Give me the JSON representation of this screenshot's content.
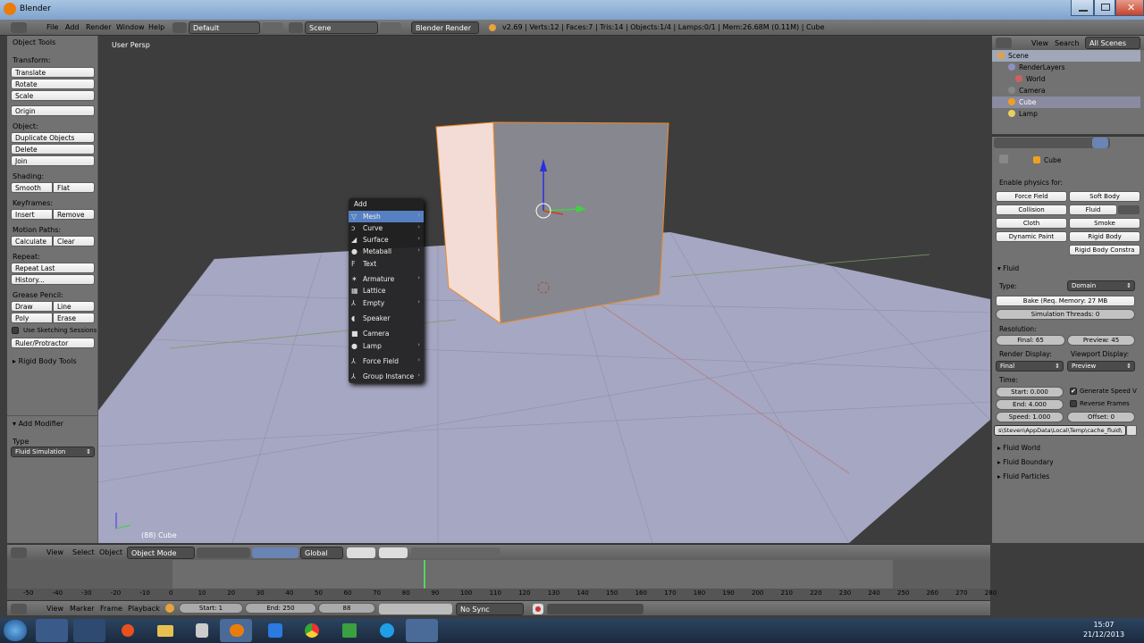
{
  "window": {
    "title": "Blender"
  },
  "menu": {
    "file": "File",
    "add": "Add",
    "render": "Render",
    "window": "Window",
    "help": "Help"
  },
  "info": {
    "layout": "Default",
    "scene": "Scene",
    "engine": "Blender Render",
    "stats": "v2.69 | Verts:12 | Faces:7 | Tris:14 | Objects:1/4 | Lamps:0/1 | Mem:26.68M (0.11M) | Cube"
  },
  "tools": {
    "panel": "Object Tools",
    "transform": "Transform:",
    "translate": "Translate",
    "rotate": "Rotate",
    "scale": "Scale",
    "origin": "Origin",
    "object": "Object:",
    "duplicate": "Duplicate Objects",
    "delete": "Delete",
    "join": "Join",
    "shading": "Shading:",
    "smooth": "Smooth",
    "flat": "Flat",
    "keyframes": "Keyframes:",
    "insert": "Insert",
    "remove": "Remove",
    "motion": "Motion Paths:",
    "calculate": "Calculate",
    "clear": "Clear",
    "repeat": "Repeat:",
    "repeat_last": "Repeat Last",
    "history": "History...",
    "grease": "Grease Pencil:",
    "draw": "Draw",
    "line": "Line",
    "poly": "Poly",
    "erase": "Erase",
    "sketch": "Use Sketching Sessions",
    "ruler": "Ruler/Protractor",
    "rigid": "Rigid Body Tools",
    "add_modifier": "Add Modifier",
    "type": "Type",
    "type_value": "Fluid Simulation"
  },
  "viewport": {
    "persp": "User Persp",
    "object_label": "(88) Cube"
  },
  "addmenu": {
    "title": "Add",
    "items": [
      {
        "label": "Mesh",
        "icon": "▽",
        "sub": true
      },
      {
        "label": "Curve",
        "icon": "ↄ",
        "sub": true
      },
      {
        "label": "Surface",
        "icon": "◢",
        "sub": true
      },
      {
        "label": "Metaball",
        "icon": "●",
        "sub": true
      },
      {
        "label": "Text",
        "icon": "F",
        "sub": false
      },
      {
        "label": "Armature",
        "icon": "✶",
        "sub": true
      },
      {
        "label": "Lattice",
        "icon": "▦",
        "sub": false
      },
      {
        "label": "Empty",
        "icon": "⅄",
        "sub": true
      },
      {
        "label": "Speaker",
        "icon": "◖",
        "sub": false
      },
      {
        "label": "Camera",
        "icon": "■",
        "sub": false
      },
      {
        "label": "Lamp",
        "icon": "●",
        "sub": true
      },
      {
        "label": "Force Field",
        "icon": "⅄",
        "sub": true
      },
      {
        "label": "Group Instance",
        "icon": "⅄",
        "sub": true
      }
    ]
  },
  "vphdr": {
    "view": "View",
    "select": "Select",
    "object": "Object",
    "mode": "Object Mode",
    "orient": "Global"
  },
  "timeline": {
    "ticks": [
      "-50",
      "-40",
      "-30",
      "-20",
      "-10",
      "0",
      "10",
      "20",
      "30",
      "40",
      "50",
      "60",
      "70",
      "80",
      "90",
      "100",
      "110",
      "120",
      "130",
      "140",
      "150",
      "160",
      "170",
      "180",
      "190",
      "200",
      "210",
      "220",
      "230",
      "240",
      "250",
      "260",
      "270",
      "280"
    ]
  },
  "tlhdr": {
    "view": "View",
    "marker": "Marker",
    "frame": "Frame",
    "playback": "Playback",
    "start": "Start: 1",
    "end": "End: 250",
    "current": "88",
    "sync": "No Sync"
  },
  "outliner": {
    "view": "View",
    "search": "Search",
    "all": "All Scenes",
    "rows": [
      "Scene",
      "RenderLayers",
      "World",
      "Camera",
      "Cube",
      "Lamp"
    ]
  },
  "props": {
    "object": "Cube",
    "enable": "Enable physics for:",
    "force_field": "Force Field",
    "soft_body": "Soft Body",
    "collision": "Collision",
    "fluid": "Fluid",
    "cloth": "Cloth",
    "smoke": "Smoke",
    "dynamic_paint": "Dynamic Paint",
    "rigid_body": "Rigid Body",
    "rigid_body_con": "Rigid Body Constra",
    "fluid_panel": "Fluid",
    "type_label": "Type:",
    "type_value": "Domain",
    "bake": "Bake (Req. Memory: 27 MB",
    "threads": "Simulation Threads: 0",
    "resolution": "Resolution:",
    "final": "Final: 65",
    "preview": "Preview: 45",
    "render_disp": "Render Display:",
    "viewport_disp": "Viewport Display:",
    "render_val": "Final",
    "viewport_val": "Preview",
    "time": "Time:",
    "start": "Start: 0.000",
    "end": "End: 4.000",
    "speed": "Speed: 1.000",
    "offset": "Offset: 0",
    "gen_speed": "Generate Speed V",
    "reverse": "Reverse Frames",
    "path": "s\\Steven\\AppData\\Local\\Temp\\cache_fluid\\",
    "fluid_world": "Fluid World",
    "fluid_boundary": "Fluid Boundary",
    "fluid_particles": "Fluid Particles"
  },
  "clock": {
    "time": "15:07",
    "date": "21/12/2013"
  }
}
